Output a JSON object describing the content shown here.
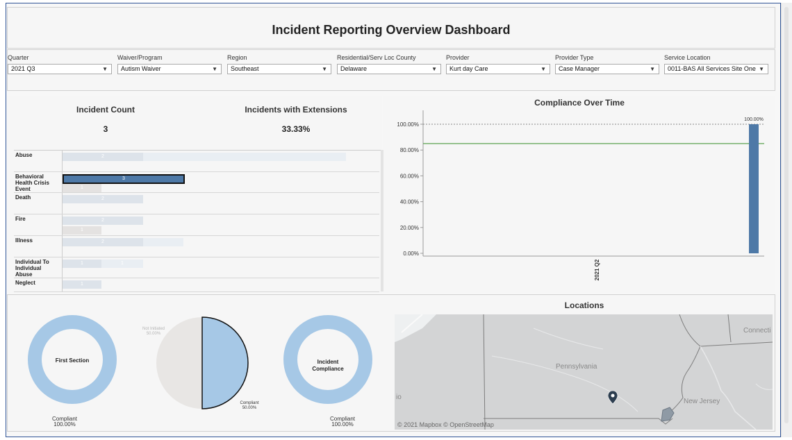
{
  "dashboard": {
    "title": "Incident Reporting Overview Dashboard"
  },
  "filters": [
    {
      "label": "Quarter",
      "value": "2021 Q3"
    },
    {
      "label": "Waiver/Program",
      "value": "Autism Waiver"
    },
    {
      "label": "Region",
      "value": "Southeast"
    },
    {
      "label": "Residential/Serv Loc County",
      "value": "Delaware"
    },
    {
      "label": "Provider",
      "value": "Kurt day Care"
    },
    {
      "label": "Provider Type",
      "value": "Case Manager"
    },
    {
      "label": "Service Location",
      "value": "0011-BAS All Services Site One"
    }
  ],
  "kpis": {
    "incident_count_title": "Incident Count",
    "incident_count_value": "3",
    "extensions_title": "Incidents with Extensions",
    "extensions_value": "33.33%"
  },
  "incident_types": {
    "rows": [
      {
        "label": "Abuse",
        "bars": [
          {
            "value": "2",
            "tone": "light"
          },
          {
            "value": "",
            "tone": "lighter"
          }
        ]
      },
      {
        "label": "Behavioral Health Crisis Event",
        "bars": [
          {
            "value": "3",
            "tone": "dark"
          },
          {
            "value": "1",
            "tone": "grey"
          }
        ]
      },
      {
        "label": "Death",
        "bars": [
          {
            "value": "2",
            "tone": "light"
          }
        ]
      },
      {
        "label": "Fire",
        "bars": [
          {
            "value": "2",
            "tone": "light"
          },
          {
            "value": "1",
            "tone": "grey"
          }
        ]
      },
      {
        "label": "Illness",
        "bars": [
          {
            "value": "2",
            "tone": "light"
          },
          {
            "value": "",
            "tone": "lighter"
          }
        ]
      },
      {
        "label": "Individual To Individual Abuse",
        "bars": [
          {
            "value": "1",
            "tone": "light"
          },
          {
            "value": "1",
            "tone": "lighter"
          }
        ]
      },
      {
        "label": "Neglect",
        "bars": [
          {
            "value": "1",
            "tone": "light"
          }
        ]
      }
    ]
  },
  "compliance_over_time": {
    "title": "Compliance Over Time",
    "chart_data": {
      "type": "bar",
      "categories": [
        "2021 Q2"
      ],
      "values": [
        100
      ],
      "value_labels": [
        "100.00%"
      ],
      "ylim": [
        0,
        100
      ],
      "yticks": [
        "0.00%",
        "20.00%",
        "40.00%",
        "60.00%",
        "80.00%",
        "100.00%"
      ],
      "reference_line": 85,
      "bar_color": "#4e79a7",
      "reference_color": "#59a14f"
    }
  },
  "donuts": {
    "first_section_center": "First Section",
    "first_section_compliant": "Compliant",
    "first_section_value": "100.00%",
    "pie_not_initiated": "Not Initiated",
    "pie_not_initiated_value": "50.00%",
    "pie_compliant": "Compliant",
    "pie_compliant_value": "50.00%",
    "incident_compliance_center": "Incident Compliance",
    "incident_compliance_compliant": "Compliant",
    "incident_compliance_value": "100.00%"
  },
  "locations": {
    "title": "Locations",
    "labels": {
      "pennsylvania": "Pennsylvania",
      "new_jersey": "New Jersey",
      "connecticut": "Connecti",
      "ohio": "io"
    },
    "attribution": "© 2021 Mapbox  © OpenStreetMap"
  },
  "colors": {
    "accent": "#4e79a7",
    "donut": "#a6c8e6",
    "pie_grey": "#e8e6e4",
    "target": "#59a14f"
  }
}
